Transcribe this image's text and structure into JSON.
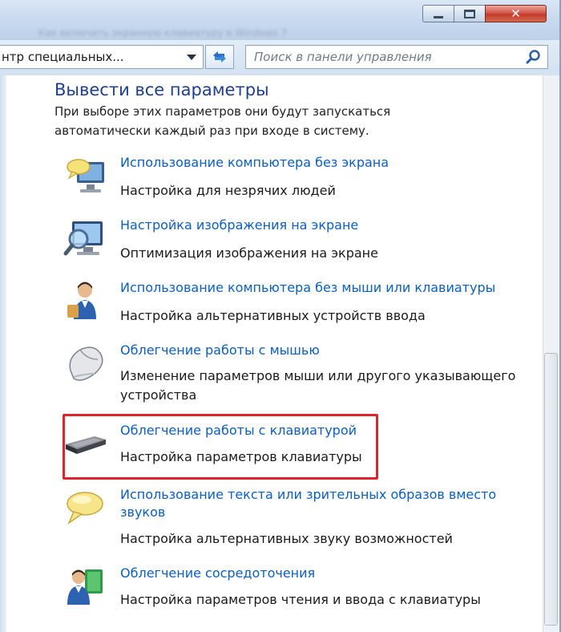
{
  "window": {
    "title_blurred": "Как включить экранную клавиатуру в Windows 7",
    "controls": {
      "minimize": "minimize",
      "maximize": "maximize",
      "close": "✕"
    }
  },
  "address": {
    "breadcrumb": "нтр специальных...",
    "search_placeholder": "Поиск в панели управления"
  },
  "section": {
    "title": "Вывести все параметры",
    "description": "При выборе этих параметров они будут запускаться автоматически каждый раз при входе в систему."
  },
  "items": [
    {
      "icon": "monitor-speech-bubble-icon",
      "link": "Использование компьютера без экрана",
      "desc": "Настройка для незрячих людей"
    },
    {
      "icon": "magnifier-monitor-icon",
      "link": "Настройка изображения на экране",
      "desc": "Оптимизация изображения на экране"
    },
    {
      "icon": "user-mobility-icon",
      "link": "Использование компьютера без мыши или клавиатуры",
      "desc": "Настройка альтернативных устройств ввода"
    },
    {
      "icon": "mouse-icon",
      "link": "Облегчение работы с мышью",
      "desc": "Изменение параметров мыши или другого указывающего устройства"
    },
    {
      "icon": "keyboard-icon",
      "link": "Облегчение работы с клавиатурой",
      "desc": "Настройка параметров клавиатуры"
    },
    {
      "icon": "speech-bubble-icon",
      "link": "Использование текста или зрительных образов вместо звуков",
      "desc": "Настройка альтернативных звуку возможностей"
    },
    {
      "icon": "user-book-icon",
      "link": "Облегчение сосредоточения",
      "desc": "Настройка параметров чтения и ввода с клавиатуры"
    }
  ],
  "colors": {
    "link": "#0a5fbf",
    "title": "#1e3f8f",
    "highlight": "#e0242d"
  }
}
